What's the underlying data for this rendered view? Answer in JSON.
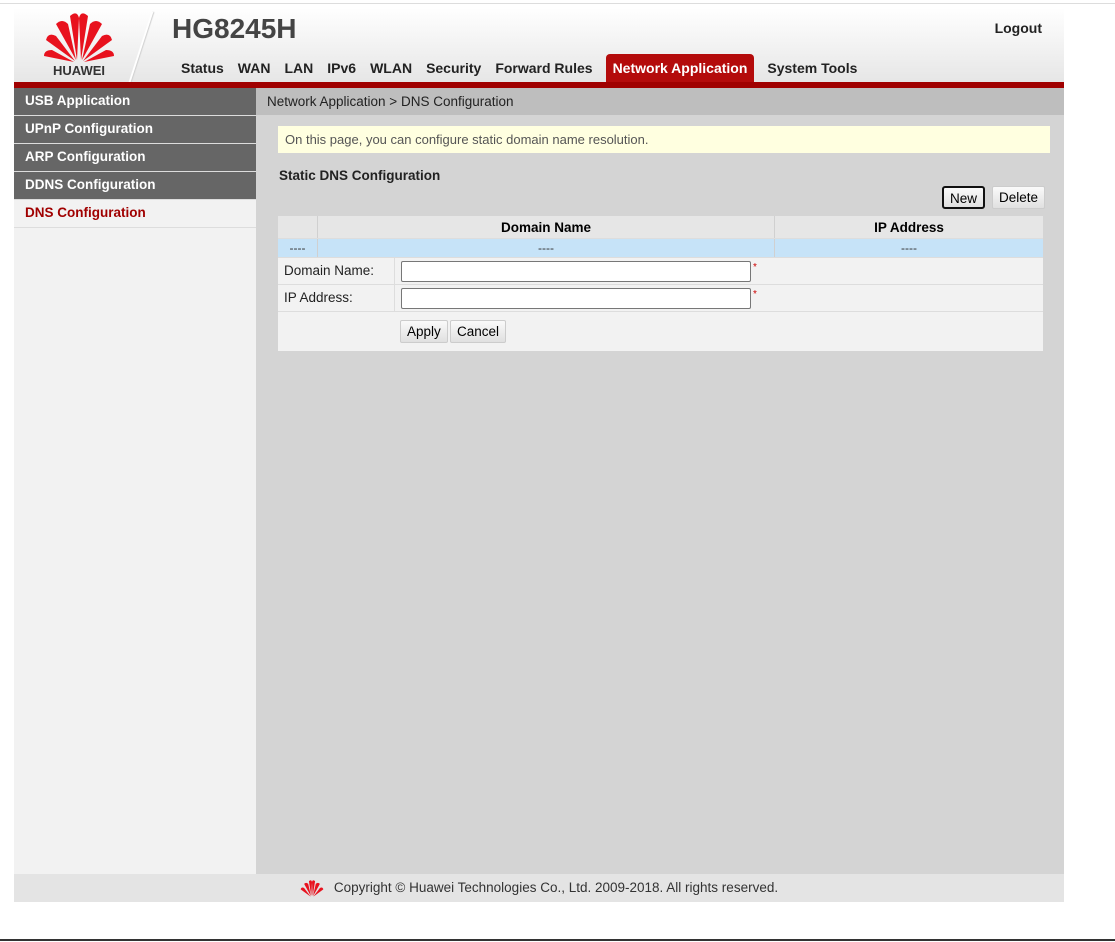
{
  "header": {
    "brand": "HUAWEI",
    "model": "HG8245H",
    "logout": "Logout"
  },
  "nav": [
    "Status",
    "WAN",
    "LAN",
    "IPv6",
    "WLAN",
    "Security",
    "Forward Rules",
    "Network Application",
    "System Tools"
  ],
  "nav_active": "Network Application",
  "sidebar": [
    "USB Application",
    "UPnP Configuration",
    "ARP Configuration",
    "DDNS Configuration",
    "DNS Configuration"
  ],
  "breadcrumb": "Network Application > DNS Configuration",
  "tip": "On this page, you can configure static domain name resolution.",
  "section_title": "Static DNS Configuration",
  "buttons": {
    "new": "New",
    "delete": "Delete",
    "apply": "Apply",
    "cancel": "Cancel"
  },
  "table": {
    "headers": [
      "",
      "Domain Name",
      "IP Address"
    ],
    "rows": [
      [
        "----",
        "----",
        "----"
      ]
    ]
  },
  "form": {
    "domain_label": "Domain Name:",
    "domain_value": "",
    "ip_label": "IP Address:",
    "ip_value": "",
    "required_mark": "*"
  },
  "footer": "Copyright © Huawei Technologies Co., Ltd. 2009-2018. All rights reserved.",
  "colors": {
    "accent": "#b40b0b",
    "sidebar": "#666666",
    "content": "#d4d4d4"
  }
}
